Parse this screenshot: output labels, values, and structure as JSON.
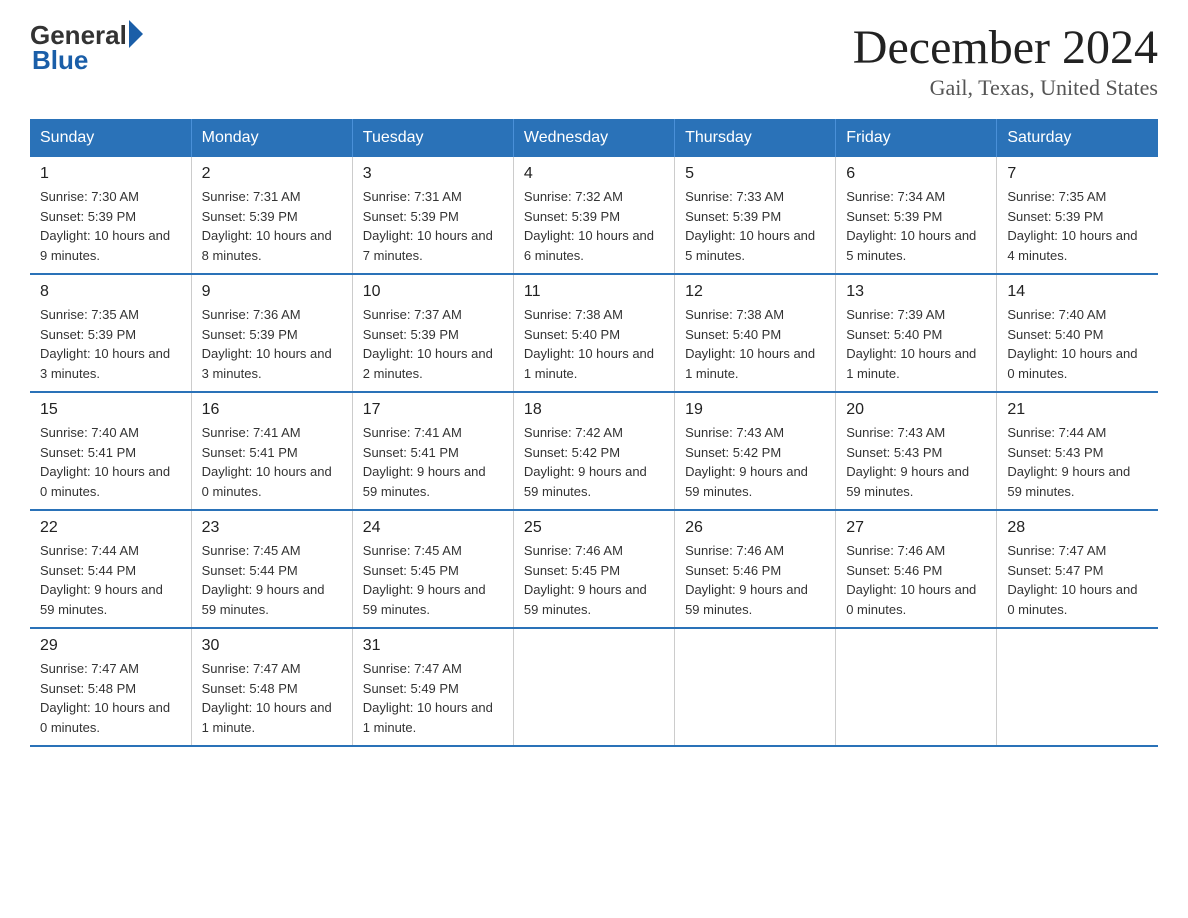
{
  "logo": {
    "text_general": "General",
    "text_blue": "Blue"
  },
  "title": {
    "month": "December 2024",
    "location": "Gail, Texas, United States"
  },
  "days_header": [
    "Sunday",
    "Monday",
    "Tuesday",
    "Wednesday",
    "Thursday",
    "Friday",
    "Saturday"
  ],
  "weeks": [
    [
      {
        "day": "1",
        "sunrise": "7:30 AM",
        "sunset": "5:39 PM",
        "daylight": "10 hours and 9 minutes."
      },
      {
        "day": "2",
        "sunrise": "7:31 AM",
        "sunset": "5:39 PM",
        "daylight": "10 hours and 8 minutes."
      },
      {
        "day": "3",
        "sunrise": "7:31 AM",
        "sunset": "5:39 PM",
        "daylight": "10 hours and 7 minutes."
      },
      {
        "day": "4",
        "sunrise": "7:32 AM",
        "sunset": "5:39 PM",
        "daylight": "10 hours and 6 minutes."
      },
      {
        "day": "5",
        "sunrise": "7:33 AM",
        "sunset": "5:39 PM",
        "daylight": "10 hours and 5 minutes."
      },
      {
        "day": "6",
        "sunrise": "7:34 AM",
        "sunset": "5:39 PM",
        "daylight": "10 hours and 5 minutes."
      },
      {
        "day": "7",
        "sunrise": "7:35 AM",
        "sunset": "5:39 PM",
        "daylight": "10 hours and 4 minutes."
      }
    ],
    [
      {
        "day": "8",
        "sunrise": "7:35 AM",
        "sunset": "5:39 PM",
        "daylight": "10 hours and 3 minutes."
      },
      {
        "day": "9",
        "sunrise": "7:36 AM",
        "sunset": "5:39 PM",
        "daylight": "10 hours and 3 minutes."
      },
      {
        "day": "10",
        "sunrise": "7:37 AM",
        "sunset": "5:39 PM",
        "daylight": "10 hours and 2 minutes."
      },
      {
        "day": "11",
        "sunrise": "7:38 AM",
        "sunset": "5:40 PM",
        "daylight": "10 hours and 1 minute."
      },
      {
        "day": "12",
        "sunrise": "7:38 AM",
        "sunset": "5:40 PM",
        "daylight": "10 hours and 1 minute."
      },
      {
        "day": "13",
        "sunrise": "7:39 AM",
        "sunset": "5:40 PM",
        "daylight": "10 hours and 1 minute."
      },
      {
        "day": "14",
        "sunrise": "7:40 AM",
        "sunset": "5:40 PM",
        "daylight": "10 hours and 0 minutes."
      }
    ],
    [
      {
        "day": "15",
        "sunrise": "7:40 AM",
        "sunset": "5:41 PM",
        "daylight": "10 hours and 0 minutes."
      },
      {
        "day": "16",
        "sunrise": "7:41 AM",
        "sunset": "5:41 PM",
        "daylight": "10 hours and 0 minutes."
      },
      {
        "day": "17",
        "sunrise": "7:41 AM",
        "sunset": "5:41 PM",
        "daylight": "9 hours and 59 minutes."
      },
      {
        "day": "18",
        "sunrise": "7:42 AM",
        "sunset": "5:42 PM",
        "daylight": "9 hours and 59 minutes."
      },
      {
        "day": "19",
        "sunrise": "7:43 AM",
        "sunset": "5:42 PM",
        "daylight": "9 hours and 59 minutes."
      },
      {
        "day": "20",
        "sunrise": "7:43 AM",
        "sunset": "5:43 PM",
        "daylight": "9 hours and 59 minutes."
      },
      {
        "day": "21",
        "sunrise": "7:44 AM",
        "sunset": "5:43 PM",
        "daylight": "9 hours and 59 minutes."
      }
    ],
    [
      {
        "day": "22",
        "sunrise": "7:44 AM",
        "sunset": "5:44 PM",
        "daylight": "9 hours and 59 minutes."
      },
      {
        "day": "23",
        "sunrise": "7:45 AM",
        "sunset": "5:44 PM",
        "daylight": "9 hours and 59 minutes."
      },
      {
        "day": "24",
        "sunrise": "7:45 AM",
        "sunset": "5:45 PM",
        "daylight": "9 hours and 59 minutes."
      },
      {
        "day": "25",
        "sunrise": "7:46 AM",
        "sunset": "5:45 PM",
        "daylight": "9 hours and 59 minutes."
      },
      {
        "day": "26",
        "sunrise": "7:46 AM",
        "sunset": "5:46 PM",
        "daylight": "9 hours and 59 minutes."
      },
      {
        "day": "27",
        "sunrise": "7:46 AM",
        "sunset": "5:46 PM",
        "daylight": "10 hours and 0 minutes."
      },
      {
        "day": "28",
        "sunrise": "7:47 AM",
        "sunset": "5:47 PM",
        "daylight": "10 hours and 0 minutes."
      }
    ],
    [
      {
        "day": "29",
        "sunrise": "7:47 AM",
        "sunset": "5:48 PM",
        "daylight": "10 hours and 0 minutes."
      },
      {
        "day": "30",
        "sunrise": "7:47 AM",
        "sunset": "5:48 PM",
        "daylight": "10 hours and 1 minute."
      },
      {
        "day": "31",
        "sunrise": "7:47 AM",
        "sunset": "5:49 PM",
        "daylight": "10 hours and 1 minute."
      },
      null,
      null,
      null,
      null
    ]
  ]
}
